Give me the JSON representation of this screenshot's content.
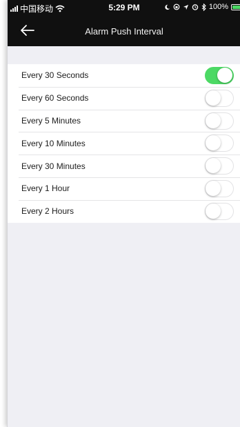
{
  "status_bar": {
    "carrier": "中国移动",
    "time": "5:29 PM",
    "battery": "100%"
  },
  "header": {
    "title": "Alarm Push Interval",
    "back_icon": "back-arrow-icon"
  },
  "options": [
    {
      "label": "Every 30 Seconds",
      "enabled": true
    },
    {
      "label": "Every 60 Seconds",
      "enabled": false
    },
    {
      "label": "Every 5 Minutes",
      "enabled": false
    },
    {
      "label": "Every 10 Minutes",
      "enabled": false
    },
    {
      "label": "Every 30 Minutes",
      "enabled": false
    },
    {
      "label": "Every 1 Hour",
      "enabled": false
    },
    {
      "label": "Every 2 Hours",
      "enabled": false
    }
  ],
  "colors": {
    "toggle_on": "#4cd964",
    "header_bg": "#101010",
    "page_bg": "#efeff4"
  }
}
